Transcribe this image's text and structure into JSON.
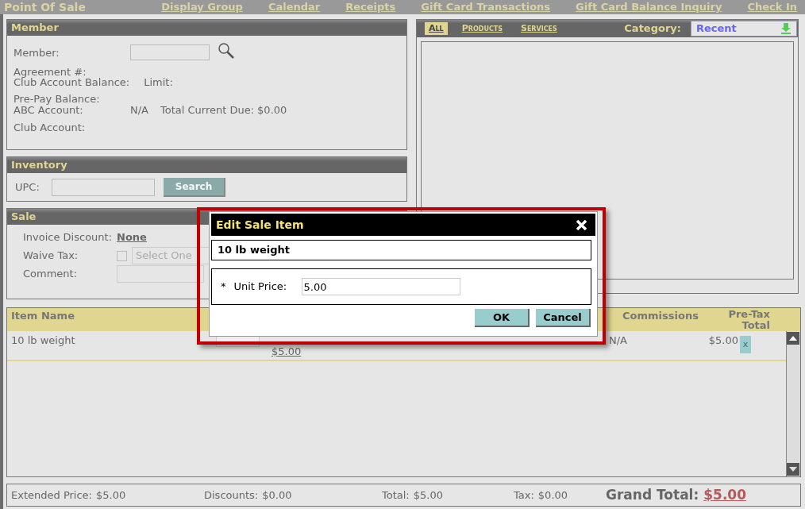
{
  "title": "Point Of Sale",
  "nav_links": [
    "Display Group",
    "Calendar",
    "Receipts",
    "Gift Card Transactions",
    "Gift Card Balance Inquiry",
    "Check In"
  ],
  "member": {
    "heading": "Member",
    "rows": [
      {
        "kind": "input",
        "label": "Member:"
      },
      {
        "kind": "text",
        "label": "Agreement #:"
      },
      {
        "kind": "pair",
        "label": "Club Account Balance:",
        "label_2": "Limit:"
      },
      {
        "kind": "text",
        "label": "Pre-Pay Balance:"
      },
      {
        "kind": "account",
        "label": "ABC Account:",
        "value": "N/A",
        "label_2": "Total Current Due:",
        "value_2": "$0.00"
      },
      {
        "kind": "text",
        "label": "Club Account:"
      }
    ]
  },
  "inventory": {
    "heading": "Inventory",
    "upc_label": "UPC:",
    "search_button": {
      "label": "Search",
      "disabled": true
    }
  },
  "sale": {
    "heading": "Sale",
    "invoice_discount_label": "Invoice Discount:",
    "invoice_discount": "None",
    "waive_tax_label": "Waive Tax:",
    "waive_tax_checked": false,
    "tax_select_placeholder": "Select One",
    "comment_label": "Comment:"
  },
  "catalog": {
    "tabs": [
      {
        "label": "All",
        "selected": true
      },
      {
        "label": "Products",
        "selected": false
      },
      {
        "label": "Services",
        "selected": false
      }
    ],
    "category_label": "Category:",
    "category": "Recent"
  },
  "table": {
    "columns": [
      "Item Name",
      "Commissions",
      "Pre-Tax Total"
    ],
    "rows": [
      {
        "item_name": "10 lb weight",
        "price": "$5.00",
        "commissions": "N/A",
        "pre_tax_total": "$5.00",
        "remove": "x"
      }
    ]
  },
  "totals": [
    {
      "label": "Extended Price:",
      "value": "$5.00"
    },
    {
      "label": "Discounts:",
      "value": "$0.00"
    },
    {
      "label": "Total:",
      "value": "$5.00"
    },
    {
      "label": "Tax:",
      "value": "$0.00"
    }
  ],
  "grand_total": {
    "label": "Grand Total:",
    "value": "$5.00"
  },
  "dialog": {
    "title": "Edit Sale Item",
    "item": "10 lb weight",
    "required_mark": "*",
    "field_label": "Unit Price:",
    "field_value": "5.00",
    "buttons": [
      "OK",
      "Cancel"
    ]
  }
}
